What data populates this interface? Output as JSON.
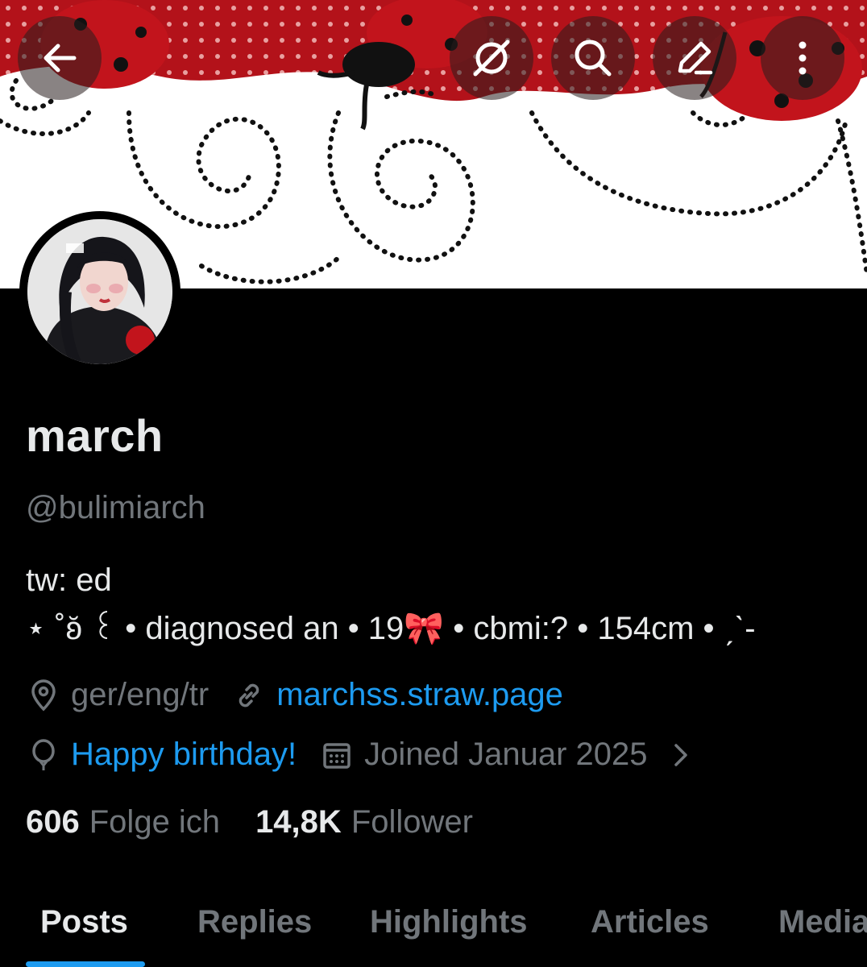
{
  "profile": {
    "display_name": "march",
    "handle": "@bulimiarch",
    "bio_line1": "tw: ed",
    "bio_line2": "⋆ ˚ʚ̆ ꒰ • diagnosed an • 19🎀 • cbmi:? • 154cm • ˏˋ-",
    "location": "ger/eng/tr",
    "website": "marchss.straw.page",
    "birthday": "Happy birthday!",
    "joined": "Joined Januar 2025"
  },
  "stats": {
    "following_count": "606",
    "following_label": "Folge ich",
    "followers_count": "14,8K",
    "followers_label": "Follower"
  },
  "tabs": [
    "Posts",
    "Replies",
    "Highlights",
    "Articles",
    "Media"
  ],
  "active_tab": "Posts",
  "colors": {
    "accent": "#1d9bf0",
    "muted": "#71767b",
    "text": "#e7e9ea",
    "background": "#000000"
  },
  "icons": [
    "back-arrow-icon",
    "grok-icon",
    "search-icon",
    "edit-icon",
    "more-icon",
    "location-icon",
    "link-icon",
    "balloon-icon",
    "calendar-icon",
    "chevron-right-icon"
  ]
}
